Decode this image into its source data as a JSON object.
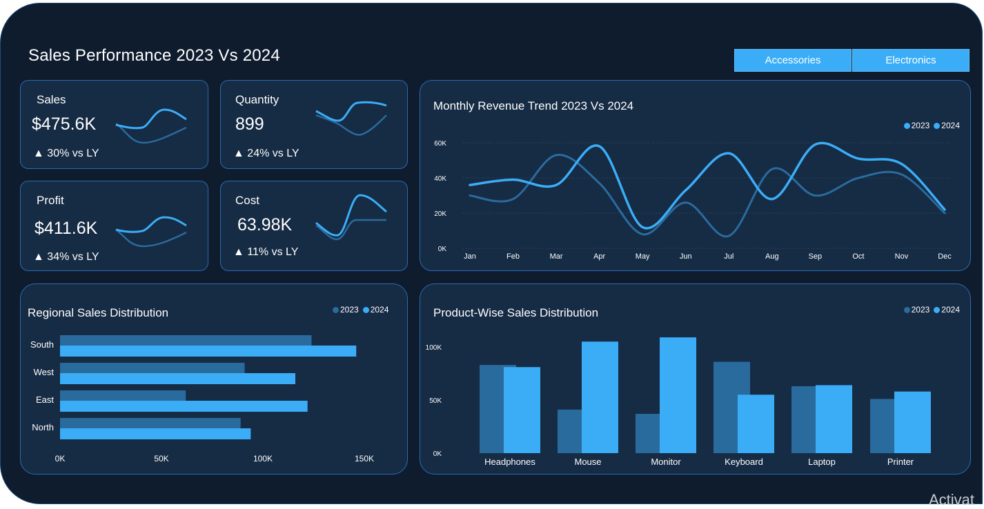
{
  "header": {
    "title": "Sales Performance 2023 Vs 2024",
    "slicers": [
      "Accessories",
      "Electronics"
    ]
  },
  "kpis": [
    {
      "label": "Sales",
      "value": "$475.6K",
      "delta": "30% vs LY",
      "arrow": "▲"
    },
    {
      "label": "Quantity",
      "value": "899",
      "delta": "24% vs LY",
      "arrow": "▲"
    },
    {
      "label": "Profit",
      "value": "$411.6K",
      "delta": "34% vs LY",
      "arrow": "▲"
    },
    {
      "label": "Cost",
      "value": "63.98K",
      "delta": "11% vs LY",
      "arrow": "▲"
    }
  ],
  "colors": {
    "y2023": "#2a6b9e",
    "y2024": "#3badf7",
    "background": "#0f1c2e",
    "card": "#162b44",
    "card_border": "#2a6cb5"
  },
  "legend": {
    "y2023": "2023",
    "y2024": "2024"
  },
  "watermark": "Activat",
  "chart_data": [
    {
      "id": "monthly",
      "type": "line",
      "title": "Monthly Revenue Trend 2023 Vs 2024",
      "x": [
        "Jan",
        "Feb",
        "Mar",
        "Apr",
        "May",
        "Jun",
        "Jul",
        "Aug",
        "Sep",
        "Oct",
        "Nov",
        "Dec"
      ],
      "ylim": [
        0,
        60000
      ],
      "yticks": [
        0,
        20000,
        40000,
        60000
      ],
      "ytick_labels": [
        "0K",
        "20K",
        "40K",
        "60K"
      ],
      "grid": true,
      "legend_position": "top-right",
      "series": [
        {
          "name": "2023",
          "values": [
            30000,
            28000,
            53000,
            37000,
            8000,
            26000,
            7000,
            45000,
            30000,
            40000,
            42000,
            20000
          ]
        },
        {
          "name": "2024",
          "values": [
            36000,
            39000,
            36000,
            58000,
            12000,
            33000,
            54000,
            28000,
            59000,
            51000,
            48000,
            22000
          ]
        }
      ]
    },
    {
      "id": "regional",
      "type": "bar",
      "orientation": "horizontal",
      "title": "Regional Sales Distribution",
      "categories": [
        "South",
        "West",
        "East",
        "North"
      ],
      "xlim": [
        0,
        150000
      ],
      "xticks": [
        0,
        50000,
        100000,
        150000
      ],
      "xtick_labels": [
        "0K",
        "50K",
        "100K",
        "150K"
      ],
      "legend_position": "top-right",
      "series": [
        {
          "name": "2023",
          "values": [
            124000,
            91000,
            62000,
            89000
          ]
        },
        {
          "name": "2024",
          "values": [
            146000,
            116000,
            122000,
            94000
          ]
        }
      ]
    },
    {
      "id": "product",
      "type": "bar",
      "title": "Product-Wise Sales Distribution",
      "categories": [
        "Headphones",
        "Mouse",
        "Monitor",
        "Keyboard",
        "Laptop",
        "Printer"
      ],
      "ylim": [
        0,
        100000
      ],
      "yticks": [
        0,
        50000,
        100000
      ],
      "ytick_labels": [
        "0K",
        "50K",
        "100K"
      ],
      "legend_position": "top-right",
      "series": [
        {
          "name": "2023",
          "values": [
            83000,
            41000,
            37000,
            86000,
            63000,
            51000
          ]
        },
        {
          "name": "2024",
          "values": [
            81000,
            105000,
            109000,
            55000,
            64000,
            58000
          ]
        }
      ]
    }
  ]
}
